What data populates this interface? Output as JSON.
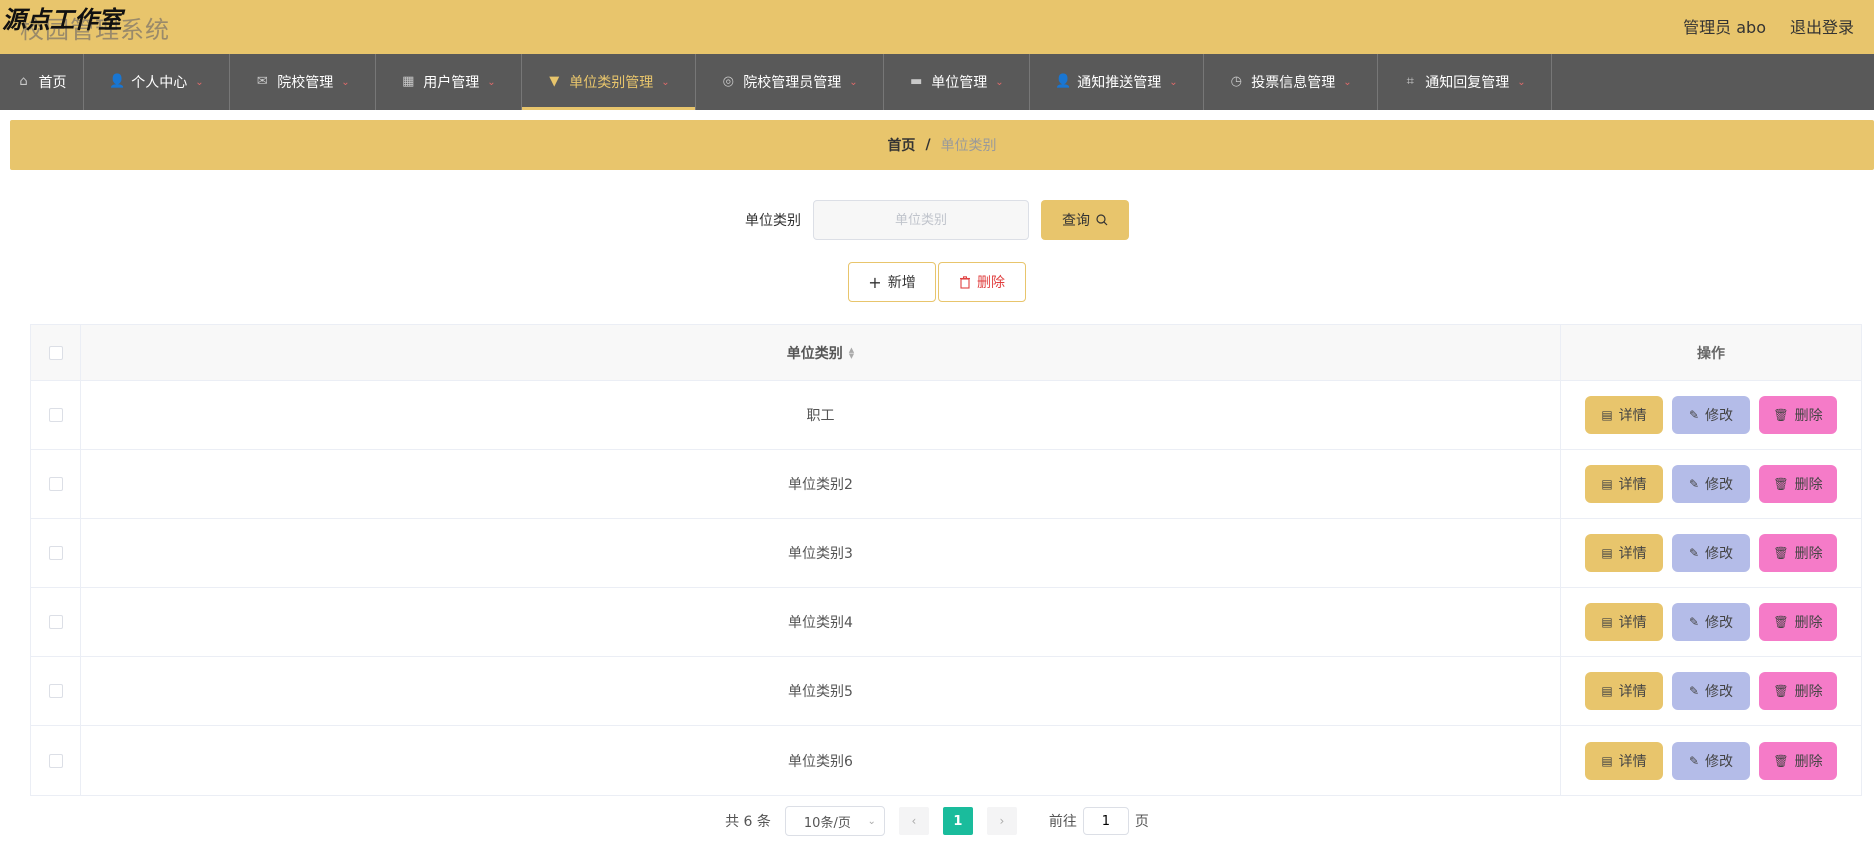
{
  "header": {
    "system_title": "校园管理系统",
    "watermark": "源点工作室",
    "user_label": "管理员 abo",
    "logout_label": "退出登录"
  },
  "nav": {
    "items": [
      {
        "label": "首页",
        "icon": "home-icon",
        "glyph": "⌂",
        "has_caret": false,
        "active": false
      },
      {
        "label": "个人中心",
        "icon": "user-icon",
        "glyph": "👤",
        "has_caret": true,
        "active": false
      },
      {
        "label": "院校管理",
        "icon": "mail-icon",
        "glyph": "✉",
        "has_caret": true,
        "active": false
      },
      {
        "label": "用户管理",
        "icon": "grid-icon",
        "glyph": "▦",
        "has_caret": true,
        "active": false
      },
      {
        "label": "单位类别管理",
        "icon": "brush-icon",
        "glyph": "▼",
        "has_caret": true,
        "active": true
      },
      {
        "label": "院校管理员管理",
        "icon": "circle-icon",
        "glyph": "◎",
        "has_caret": true,
        "active": false
      },
      {
        "label": "单位管理",
        "icon": "briefcase-icon",
        "glyph": "▬",
        "has_caret": true,
        "active": false
      },
      {
        "label": "通知推送管理",
        "icon": "person-icon",
        "glyph": "👤",
        "has_caret": true,
        "active": false
      },
      {
        "label": "投票信息管理",
        "icon": "compass-icon",
        "glyph": "◷",
        "has_caret": true,
        "active": false
      },
      {
        "label": "通知回复管理",
        "icon": "crop-icon",
        "glyph": "⌗",
        "has_caret": true,
        "active": false
      }
    ],
    "caret": "⌄"
  },
  "breadcrumb": {
    "home": "首页",
    "separator": "/",
    "current": "单位类别"
  },
  "search": {
    "label": "单位类别",
    "placeholder": "单位类别",
    "button_label": "查询",
    "button_icon": "search-icon"
  },
  "actions": {
    "add_label": "新增",
    "add_icon": "plus-icon",
    "delete_label": "删除",
    "delete_icon": "trash-icon"
  },
  "table": {
    "headers": {
      "name": "单位类别",
      "ops": "操作"
    },
    "rows": [
      {
        "name": "职工"
      },
      {
        "name": "单位类别2"
      },
      {
        "name": "单位类别3"
      },
      {
        "name": "单位类别4"
      },
      {
        "name": "单位类别5"
      },
      {
        "name": "单位类别6"
      }
    ],
    "row_buttons": {
      "detail": "详情",
      "edit": "修改",
      "remove": "删除"
    }
  },
  "pagination": {
    "total": "共 6 条",
    "page_size": "10条/页",
    "current_page": "1",
    "goto_label": "前往",
    "goto_value": "1",
    "page_suffix": "页"
  },
  "colors": {
    "accent": "#e8c56c",
    "nav_bg": "#595959",
    "edit": "#b4bce8",
    "remove": "#f57bc8",
    "page_active": "#1abc9c"
  }
}
